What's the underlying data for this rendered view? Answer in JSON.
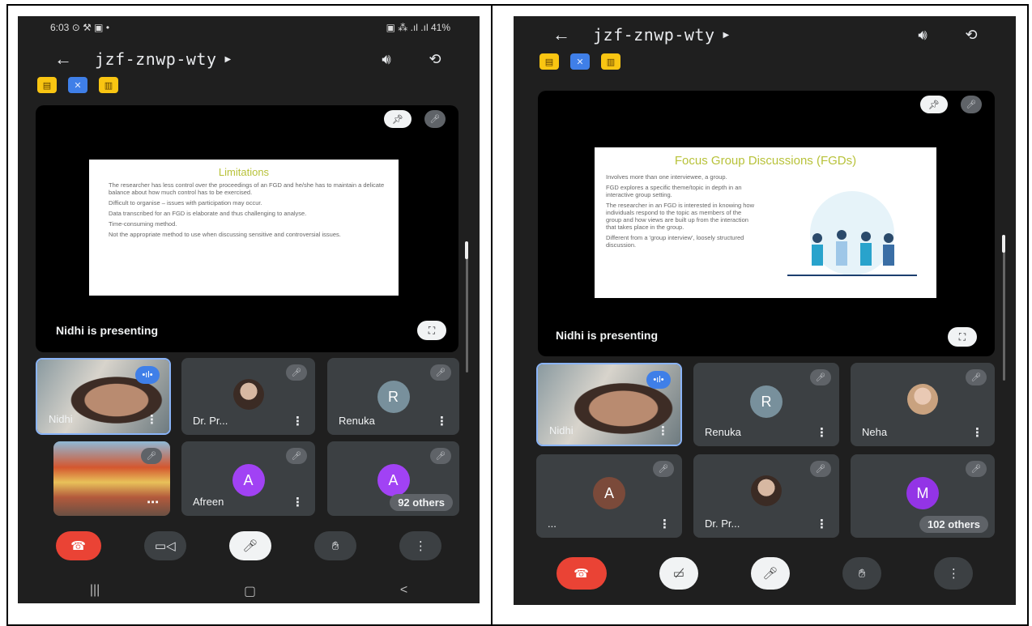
{
  "status": {
    "time": "6:03",
    "left_icons": "⊙ ⚒ ▣ •",
    "right_icons": "▣ ⁂ .ıl .ıl",
    "battery": "41%"
  },
  "meeting_code": "jzf-znwp-wty",
  "presenting_text": "Nidhi is presenting",
  "left": {
    "slide": {
      "title": "Limitations",
      "bullets": [
        "The researcher has less control over the proceedings of an FGD and he/she has to maintain a delicate balance about how much control has to be exercised.",
        "Difficult to organise – issues with participation may occur.",
        "Data transcribed for an FGD is elaborate and thus challenging to analyse.",
        "Time-consuming method.",
        "Not the appropriate method to use when discussing sensitive and controversial issues."
      ]
    },
    "tiles": [
      {
        "name": "Nidhi"
      },
      {
        "name": "Dr. Pr..."
      },
      {
        "name": "Renuka",
        "initial": "R"
      },
      {
        "name": ""
      },
      {
        "name": "Afreen",
        "initial": "A"
      },
      {
        "name": "A",
        "initial": "A",
        "others": "92 others"
      }
    ]
  },
  "right": {
    "slide": {
      "title": "Focus Group Discussions (FGDs)",
      "bullets": [
        "Involves more than one interviewee, a group.",
        "FGD explores a specific theme/topic in depth in an interactive group setting.",
        "The researcher in an FGD is interested in knowing how individuals respond to the topic as members of the group and how views are built up from the interaction that takes place in the group.",
        "Different from a 'group interview', loosely structured discussion."
      ]
    },
    "tiles": [
      {
        "name": "Nidhi"
      },
      {
        "name": "Renuka",
        "initial": "R"
      },
      {
        "name": "Neha"
      },
      {
        "name": "...",
        "initial": "A"
      },
      {
        "name": "Dr. Pr..."
      },
      {
        "name": "M",
        "initial": "M",
        "others": "102 others"
      }
    ]
  },
  "colors": {
    "end_call": "#ea4335",
    "avatar_renuka": "#78909c",
    "avatar_afreen": "#a142f4",
    "avatar_a_brown": "#7b4a3a",
    "avatar_m": "#9334e6"
  }
}
